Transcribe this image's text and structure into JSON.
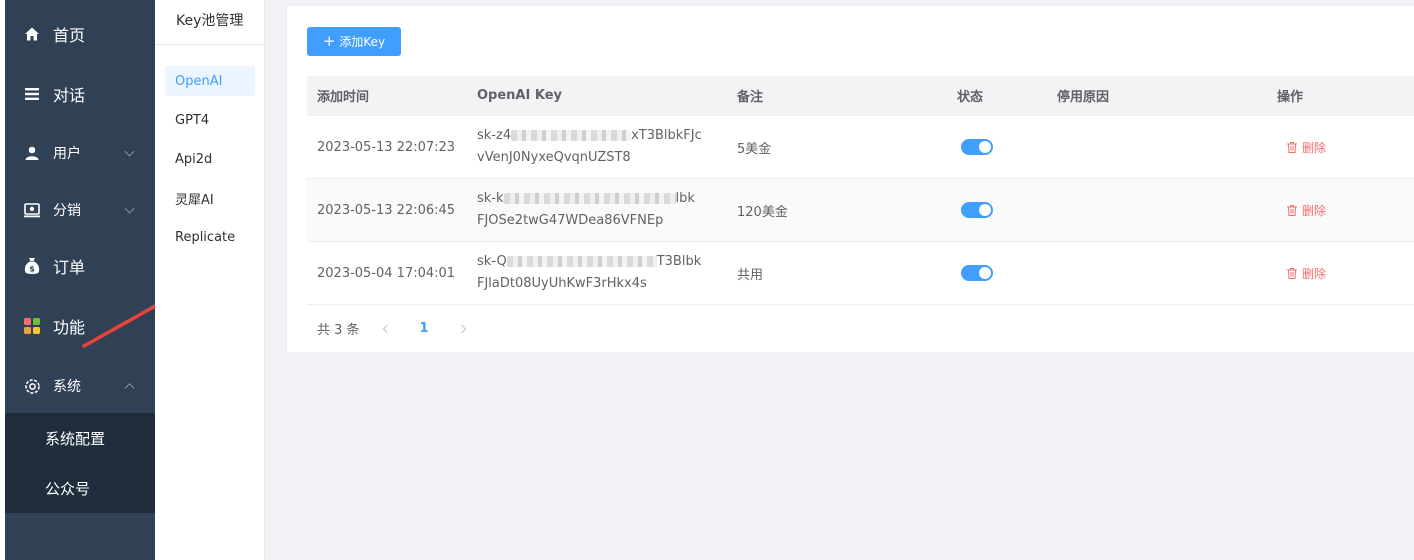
{
  "sidebar": {
    "items": [
      {
        "label": "首页",
        "icon": "home-icon"
      },
      {
        "label": "对话",
        "icon": "menu-lines-icon"
      },
      {
        "label": "用户",
        "icon": "user-icon"
      },
      {
        "label": "分销",
        "icon": "distribution-icon"
      },
      {
        "label": "订单",
        "icon": "money-bag-icon"
      },
      {
        "label": "功能",
        "icon": "apps-grid-icon"
      },
      {
        "label": "系统",
        "icon": "gear-icon"
      }
    ],
    "submenu": [
      "系统配置",
      "公众号"
    ]
  },
  "sub_sidebar": {
    "title": "Key池管理",
    "providers": [
      "OpenAI",
      "GPT4",
      "Api2d",
      "灵犀AI",
      "Replicate"
    ],
    "active": "OpenAI"
  },
  "toolbar": {
    "add_label": "添加Key"
  },
  "table": {
    "headers": [
      "添加时间",
      "OpenAI Key",
      "备注",
      "状态",
      "停用原因",
      "操作"
    ],
    "rows": [
      {
        "time": "2023-05-13 22:07:23",
        "key_prefix": "sk-z4",
        "key_suffix_line1": "xT3BlbkFJc",
        "key_line2": "vVenJ0NyxeQvqnUZST8",
        "note": "5美金",
        "enabled": true,
        "reason": "",
        "action": "删除"
      },
      {
        "time": "2023-05-13 22:06:45",
        "key_prefix": "sk-k",
        "key_suffix_line1": "lbk",
        "key_line2": "FJOSe2twG47WDea86VFNEp",
        "note": "120美金",
        "enabled": true,
        "reason": "",
        "action": "删除"
      },
      {
        "time": "2023-05-04 17:04:01",
        "key_prefix": "sk-Q",
        "key_suffix_line1": "T3Blbk",
        "key_line2": "FJlaDt08UyUhKwF3rHkx4s",
        "note": "共用",
        "enabled": true,
        "reason": "",
        "action": "删除"
      }
    ]
  },
  "pagination": {
    "total_text": "共 3 条",
    "current_page": "1"
  },
  "colors": {
    "primary": "#409eff",
    "sidebar_bg": "#304156",
    "danger": "#f56c6c",
    "annotation": "#e8433a"
  }
}
